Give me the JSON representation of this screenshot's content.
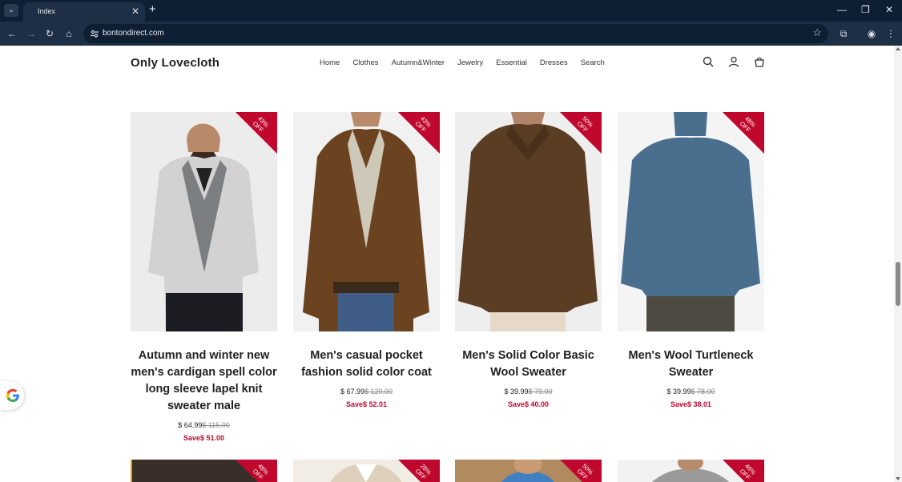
{
  "tab_bar": {
    "tab_title": "Index"
  },
  "toolbar": {
    "url": "bontondirect.com"
  },
  "header": {
    "brand": "Only Lovecloth",
    "nav": [
      "Home",
      "Clothes",
      "Autumn&Winter",
      "Jewelry",
      "Essential",
      "Dresses",
      "Search"
    ]
  },
  "products": [
    {
      "badge_line1": "43%",
      "badge_line2": "OFF",
      "title": "Autumn and winter new men's cardigan spell color long sleeve lapel knit sweater male",
      "price": "$ 64.99",
      "old_price": "$ 115.00",
      "save": "Save$ 51.00",
      "garment_color": "#cfcfcf"
    },
    {
      "badge_line1": "43%",
      "badge_line2": "OFF",
      "title": "Men's casual pocket fashion solid color coat",
      "price": "$ 67.99",
      "old_price": "$ 120.00",
      "save": "Save$ 52.01",
      "garment_color": "#6b4320"
    },
    {
      "badge_line1": "50%",
      "badge_line2": "OFF",
      "title": "Men's Solid Color Basic Wool Sweater",
      "price": "$ 39.99",
      "old_price": "$ 79.00",
      "save": "Save$ 40.00",
      "garment_color": "#5a3d22"
    },
    {
      "badge_line1": "48%",
      "badge_line2": "OFF",
      "title": "Men's Wool Turtleneck Sweater",
      "price": "$ 39.99",
      "old_price": "$ 78.00",
      "save": "Save$ 38.01",
      "garment_color": "#4a6f8e"
    }
  ],
  "next_row_badges": [
    {
      "line1": "48%",
      "line2": "OFF"
    },
    {
      "line1": "28%",
      "line2": "OFF"
    },
    {
      "line1": "50%",
      "line2": "OFF"
    },
    {
      "line1": "46%",
      "line2": "OFF"
    }
  ],
  "colors": {
    "accent": "#c0082e",
    "browser_frame": "#0f1f33",
    "browser_toolbar": "#1d2e45"
  }
}
